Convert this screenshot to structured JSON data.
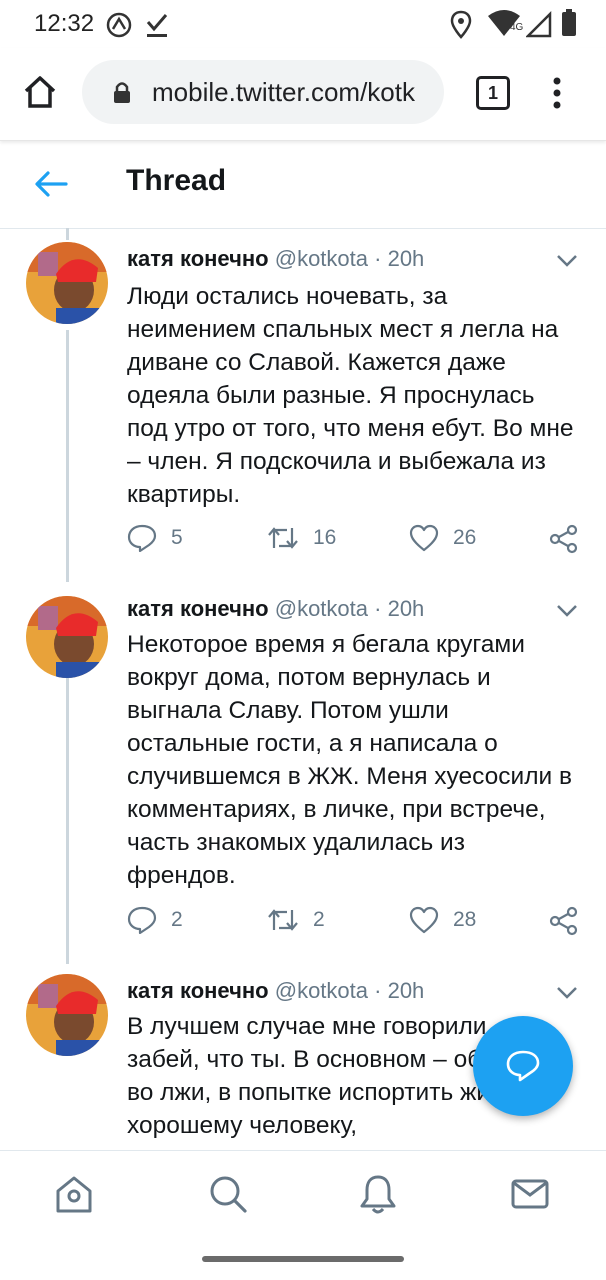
{
  "status_bar": {
    "time": "12:32",
    "network": "4G"
  },
  "browser": {
    "url": "mobile.twitter.com/kotk",
    "tab_count": "1"
  },
  "header": {
    "title": "Thread"
  },
  "colors": {
    "accent": "#1da1f2",
    "text": "#14171a",
    "secondary": "#657786",
    "divider": "#e1e8ed"
  },
  "tweets": [
    {
      "name": "катя конечно",
      "handle": "@kotkota",
      "time": "20h",
      "text": "Люди остались ночевать, за неимением спальных мест я легла на диване со Славой. Кажется даже одеяла были разные. Я проснулась под утро от того, что меня ебут. Во мне – член. Я подскочила и выбежала из квартиры.",
      "replies": "5",
      "retweets": "16",
      "likes": "26"
    },
    {
      "name": "катя конечно",
      "handle": "@kotkota",
      "time": "20h",
      "text": "Некоторое время я бегала кругами вокруг дома, потом вернулась и выгнала Славу. Потом ушли остальные гости, а я написала о случившемся в ЖЖ. Меня хуесосили в комментариях, в личке, при встрече, часть знакомых удалилась из френдов.",
      "replies": "2",
      "retweets": "2",
      "likes": "28"
    },
    {
      "name": "катя конечно",
      "handle": "@kotkota",
      "time": "20h",
      "text": "В лучшем случае мне говорили «ну забей, что ты. В основном – обвиняли во лжи, в попытке испортить жизнь хорошему человеку,"
    }
  ],
  "bottom_nav": [
    "home-icon",
    "search-icon",
    "notifications-icon",
    "messages-icon"
  ]
}
